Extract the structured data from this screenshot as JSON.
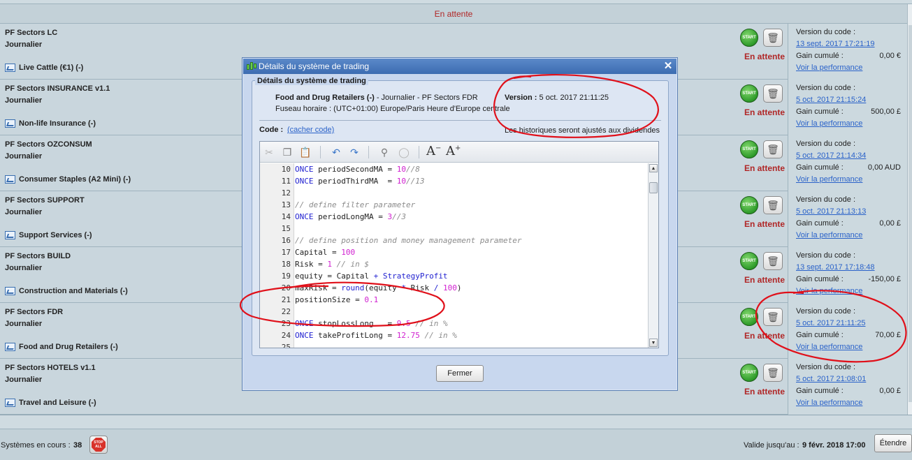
{
  "header": {
    "status_title": "En attente"
  },
  "row_labels": {
    "version_label": "Version du code :",
    "gain_label": "Gain cumulé :",
    "perf_link": "Voir la performance",
    "start_label": "START",
    "status": "En attente"
  },
  "systems": [
    {
      "name": "PF Sectors LC",
      "frequency": "Journalier",
      "instrument": "Live Cattle (€1) (-)",
      "version_date": "13 sept. 2017 17:21:19",
      "gain": "0,00 €"
    },
    {
      "name": "PF Sectors INSURANCE v1.1",
      "frequency": "Journalier",
      "instrument": "Non-life Insurance (-)",
      "version_date": "5 oct. 2017 21:15:24",
      "gain": "500,00 £"
    },
    {
      "name": "PF Sectors OZCONSUM",
      "frequency": "Journalier",
      "instrument": "Consumer Staples (A2 Mini) (-)",
      "version_date": "5 oct. 2017 21:14:34",
      "gain": "0,00 AUD"
    },
    {
      "name": "PF Sectors SUPPORT",
      "frequency": "Journalier",
      "instrument": "Support Services (-)",
      "version_date": "5 oct. 2017 21:13:13",
      "gain": "0,00 £"
    },
    {
      "name": "PF Sectors BUILD",
      "frequency": "Journalier",
      "instrument": "Construction and Materials (-)",
      "version_date": "13 sept. 2017 17:18:48",
      "gain": "-150,00 £"
    },
    {
      "name": "PF Sectors FDR",
      "frequency": "Journalier",
      "instrument": "Food and Drug Retailers (-)",
      "version_date": "5 oct. 2017 21:11:25",
      "gain": "70,00 £"
    },
    {
      "name": "PF Sectors HOTELS v1.1",
      "frequency": "Journalier",
      "instrument": "Travel and Leisure (-)",
      "version_date": "5 oct. 2017 21:08:01",
      "gain": "0,00 £"
    }
  ],
  "footer": {
    "systems_running_label": "Systèmes en cours :",
    "systems_running_count": "38",
    "stop_all_label": "STOP ALL",
    "valid_until_label": "Valide jusqu'au :",
    "valid_until_date": "9 févr. 2018 17:00",
    "extend_label": "Étendre"
  },
  "modal": {
    "title": "Détails du système de trading",
    "section_title": "Détails du système de trading",
    "instrument_bold": "Food and Drug Retailers (-)",
    "instrument_rest": " - Journalier - PF Sectors FDR",
    "version_label": "Version :",
    "version_value": " 5 oct. 2017 21:11:25",
    "timezone": "Fuseau horaire : (UTC+01:00) Europe/Paris Heure d'Europe centrale",
    "code_label": "Code :",
    "hide_code_link": "(cacher code)",
    "dividend_note": "Les historiques seront ajustés aux dividendes",
    "close_button": "Fermer",
    "font_minus": "−",
    "font_plus": "+",
    "code_lines": [
      {
        "n": "10",
        "parts": [
          [
            "kw",
            "ONCE"
          ],
          [
            "t",
            " periodSecondMA = "
          ],
          [
            "num",
            "10"
          ],
          [
            "cmt",
            "//8"
          ]
        ]
      },
      {
        "n": "11",
        "parts": [
          [
            "kw",
            "ONCE"
          ],
          [
            "t",
            " periodThirdMA  = "
          ],
          [
            "num",
            "10"
          ],
          [
            "cmt",
            "//13"
          ]
        ]
      },
      {
        "n": "12",
        "parts": []
      },
      {
        "n": "13",
        "parts": [
          [
            "cmt",
            "// define filter parameter"
          ]
        ]
      },
      {
        "n": "14",
        "parts": [
          [
            "kw",
            "ONCE"
          ],
          [
            "t",
            " periodLongMA = "
          ],
          [
            "num",
            "3"
          ],
          [
            "cmt",
            "//3"
          ]
        ]
      },
      {
        "n": "15",
        "parts": []
      },
      {
        "n": "16",
        "parts": [
          [
            "cmt",
            "// define position and money management parameter"
          ]
        ]
      },
      {
        "n": "17",
        "parts": [
          [
            "t",
            "Capital = "
          ],
          [
            "num",
            "100"
          ]
        ]
      },
      {
        "n": "18",
        "parts": [
          [
            "t",
            "Risk = "
          ],
          [
            "num",
            "1"
          ],
          [
            "t",
            " "
          ],
          [
            "cmt",
            "// in $"
          ]
        ]
      },
      {
        "n": "19",
        "parts": [
          [
            "t",
            "equity = Capital "
          ],
          [
            "op",
            "+"
          ],
          [
            "t",
            " "
          ],
          [
            "kw",
            "StrategyProfit"
          ]
        ]
      },
      {
        "n": "20",
        "parts": [
          [
            "t",
            "maxRisk = "
          ],
          [
            "kw",
            "round"
          ],
          [
            "t",
            "(equity "
          ],
          [
            "op",
            "*"
          ],
          [
            "t",
            " Risk "
          ],
          [
            "op",
            "/"
          ],
          [
            "t",
            " "
          ],
          [
            "num",
            "100"
          ],
          [
            "t",
            ")"
          ]
        ]
      },
      {
        "n": "21",
        "parts": [
          [
            "t",
            "positionSize = "
          ],
          [
            "num",
            "0.1"
          ]
        ]
      },
      {
        "n": "22",
        "parts": []
      },
      {
        "n": "23",
        "parts": [
          [
            "kw",
            "ONCE"
          ],
          [
            "t",
            " stopLossLong   = "
          ],
          [
            "num",
            "9.5"
          ],
          [
            "t",
            " "
          ],
          [
            "cmt",
            "// in %"
          ]
        ]
      },
      {
        "n": "24",
        "parts": [
          [
            "kw",
            "ONCE"
          ],
          [
            "t",
            " takeProfitLong = "
          ],
          [
            "num",
            "12.75"
          ],
          [
            "t",
            " "
          ],
          [
            "cmt",
            "// in %"
          ]
        ]
      },
      {
        "n": "25",
        "parts": []
      }
    ]
  },
  "colors": {
    "status_red": "#b02626",
    "link_blue": "#2a62c9",
    "annotation_red": "#e0101a",
    "start_green": "#2e9b2a"
  },
  "icons": {
    "row": [
      "chart-icon",
      "start-icon",
      "trash-icon"
    ],
    "toolbar": [
      "cut-icon",
      "copy-icon",
      "paste-icon",
      "undo-icon",
      "redo-icon",
      "search-icon",
      "comment-icon",
      "font-decrease-icon",
      "font-increase-icon"
    ]
  }
}
